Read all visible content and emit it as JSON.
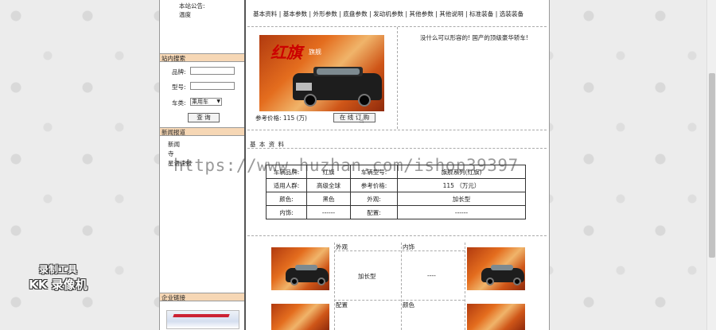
{
  "sidebar": {
    "notice_title": "本站公告:",
    "notice_item": "温度",
    "search_header": "站内搜索",
    "brand_label": "品牌:",
    "model_label": "型号:",
    "type_label": "车类:",
    "type_value": "乘用车",
    "query_button": "查 询",
    "news_header": "新闻报道",
    "news_items": [
      "新闻",
      "寺",
      "星语速报"
    ],
    "links_header": "企业链接"
  },
  "tabs": [
    "基本资料",
    "基本参数",
    "外形参数",
    "底盘参数",
    "发动机参数",
    "其他参数",
    "其他说明",
    "标准装备",
    "选装装备"
  ],
  "product": {
    "image_logo": "红旗",
    "image_sub": "旗舰",
    "price_text": "参考价格: 115 (万)",
    "order_button": "在 线 订 购",
    "slogan": "没什么可以形容的! 国产的顶级豪华轿车!"
  },
  "basic_info": {
    "section_title": "基 本 资 料",
    "rows": [
      [
        "车辆品牌:",
        "红旗",
        "车辆型号:",
        "旗舰系列(红旗)"
      ],
      [
        "适用人群:",
        "高级全球",
        "参考价格:",
        "115 （万元）"
      ],
      [
        "颜色:",
        "黑色",
        "外观:",
        "加长型"
      ],
      [
        "内饰:",
        "------",
        "配置:",
        "------"
      ]
    ]
  },
  "gallery": {
    "labels": [
      "外观",
      "内饰",
      "配置",
      "颜色"
    ],
    "exterior_value": "加长型",
    "interior_value": "----"
  },
  "watermark": "https://www.huzhan.com/ishop39397",
  "recorder": {
    "line1": "录制工具",
    "line2": "KK 录像机"
  }
}
